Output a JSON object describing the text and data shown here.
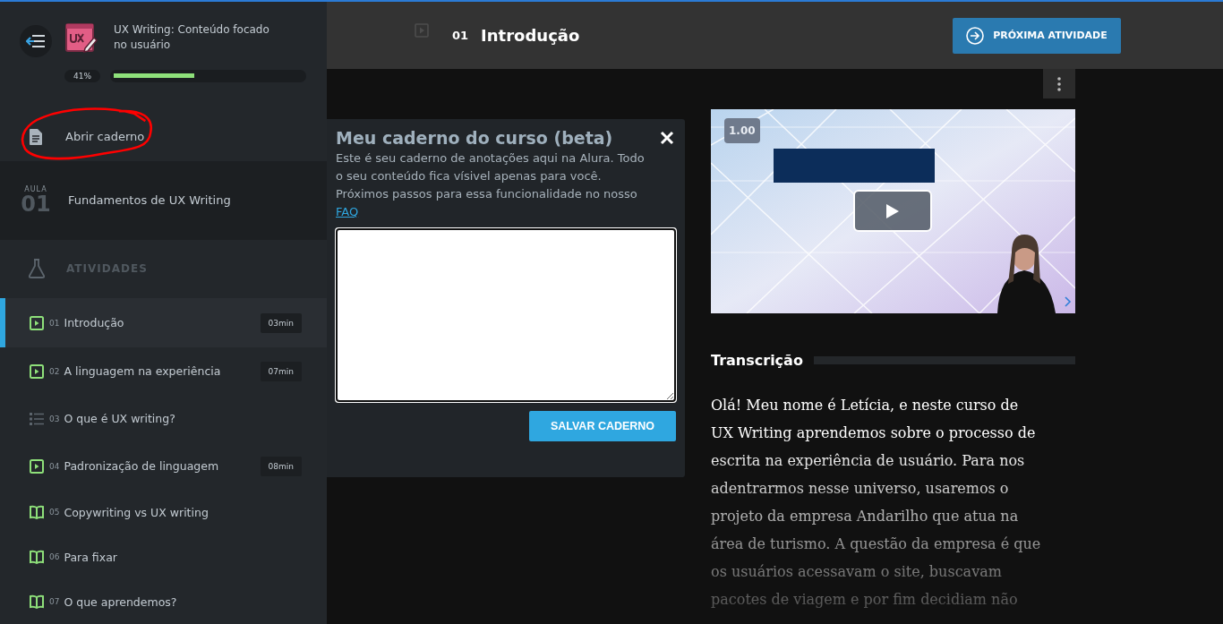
{
  "course": {
    "title": "UX Writing: Conteúdo focado no usuário",
    "progress_label": "41%",
    "level": 0.41
  },
  "notebook_link": {
    "label": "Abrir caderno"
  },
  "lesson": {
    "label": "AULA",
    "number": "01",
    "title": "Fundamentos de UX Writing"
  },
  "activities_header": "ATIVIDADES",
  "activities": [
    {
      "kind": "video",
      "number": "01",
      "title": "Introdução",
      "duration": "03min",
      "selected": true
    },
    {
      "kind": "video",
      "number": "02",
      "title": "A linguagem na experiência",
      "duration": "07min",
      "selected": false
    },
    {
      "kind": "list",
      "number": "03",
      "title": "O que é UX writing?",
      "selected": false
    },
    {
      "kind": "video",
      "number": "04",
      "title": "Padronização de linguagem",
      "duration": "08min",
      "selected": false
    },
    {
      "kind": "reading",
      "number": "05",
      "title": "Copywriting vs UX writing",
      "selected": false
    },
    {
      "kind": "reading",
      "number": "06",
      "title": "Para fixar",
      "selected": false
    },
    {
      "kind": "reading",
      "number": "07",
      "title": "O que aprendemos?",
      "selected": false
    }
  ],
  "header": {
    "number": "01",
    "title": "Introdução",
    "next_button": "PRÓXIMA ATIVIDADE"
  },
  "notebook": {
    "title": "Meu caderno do curso (beta)",
    "description": "Este é seu caderno de anotações aqui na Alura. Todo o seu conteúdo fica vísivel apenas para você. Próximos passos para essa funcionalidade no nosso",
    "link": "FAQ",
    "save_button": "SALVAR CADERNO"
  },
  "video": {
    "kind": "picture",
    "speed": "1.00"
  },
  "transcript": {
    "title": "Transcrição",
    "text": "Olá! Meu nome é Letícia, e neste curso de UX Writing aprendemos sobre o processo de escrita na experiência de usuário. Para nos adentrarmos nesse universo, usaremos o projeto da empresa Andarilho que atua na área de turismo. A questão da empresa é que os usuários acessavam o site, buscavam pacotes de viagem e por fim decidiam não"
  }
}
